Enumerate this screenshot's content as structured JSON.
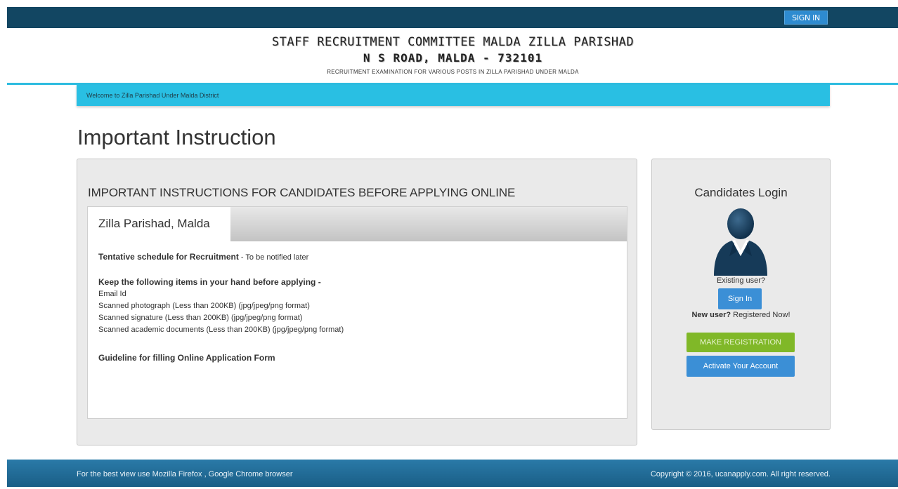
{
  "topbar": {
    "signin_label": "SIGN IN"
  },
  "header": {
    "line1": "STAFF  RECRUITMENT  COMMITTEE  MALDA  ZILLA  PARISHAD",
    "line2": "N S ROAD, MALDA - 732101",
    "line3": "RECRUITMENT EXAMINATION FOR VARIOUS POSTS IN ZILLA PARISHAD UNDER MALDA"
  },
  "welcome": "Welcome to Zilla Parishad Under Malda District",
  "page_title": "Important Instruction",
  "main": {
    "heading": "IMPORTANT INSTRUCTIONS FOR CANDIDATES BEFORE APPLYING ONLINE",
    "tab_label": "Zilla Parishad, Malda",
    "schedule_label": "Tentative schedule for Recruitment",
    "schedule_value": " - To be notified later",
    "keep_heading": "Keep the following items in your hand before applying -",
    "items": [
      "Email Id",
      "Scanned photograph (Less than 200KB) (jpg/jpeg/png format)",
      "Scanned signature (Less than 200KB) (jpg/jpeg/png format)",
      "Scanned academic documents (Less than 200KB) (jpg/jpeg/png format)"
    ],
    "guideline": "Guideline for filling Online Application Form"
  },
  "login": {
    "title": "Candidates Login",
    "existing_user": "Existing user?",
    "signin_label": "Sign In",
    "new_user_bold": "New user?",
    "new_user_rest": " Registered Now!",
    "register_label": "MAKE REGISTRATION",
    "activate_label": "Activate Your Account"
  },
  "footer": {
    "left": "For the best view use Mozilla Firefox , Google Chrome browser",
    "right": "Copyright © 2016, ucanapply.com. All right reserved."
  }
}
